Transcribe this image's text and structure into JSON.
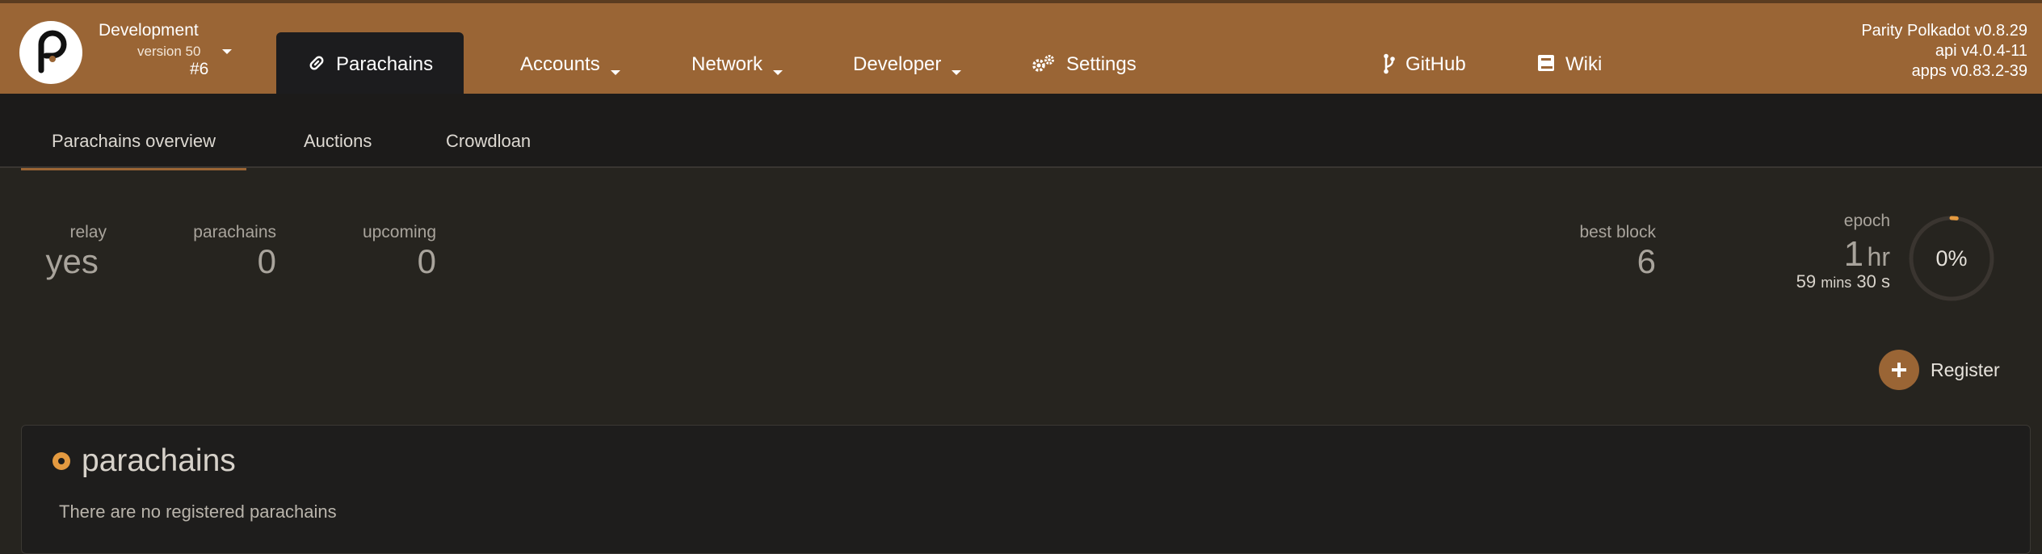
{
  "chain": {
    "name": "Development",
    "version": "version 50",
    "block": "#6"
  },
  "nav": {
    "parachains": "Parachains",
    "accounts": "Accounts",
    "network": "Network",
    "developer": "Developer",
    "settings": "Settings",
    "github": "GitHub",
    "wiki": "Wiki"
  },
  "versions": {
    "node": "Parity Polkadot v0.8.29",
    "api": "api v4.0.4-11",
    "apps": "apps v0.83.2-39"
  },
  "tabs": {
    "overview": "Parachains overview",
    "auctions": "Auctions",
    "crowdloan": "Crowdloan"
  },
  "summary": {
    "relay_label": "relay",
    "relay_value": "yes",
    "parachains_label": "parachains",
    "parachains_value": "0",
    "upcoming_label": "upcoming",
    "upcoming_value": "0",
    "best_block_label": "best block",
    "best_block_value": "6",
    "epoch_label": "epoch",
    "epoch_value": "1",
    "epoch_unit": "hr",
    "epoch_remaining": "59",
    "epoch_mins_label": "mins",
    "epoch_secs": "30",
    "epoch_secs_label": "s",
    "epoch_percent": "0%",
    "epoch_progress": 0.02
  },
  "actions": {
    "register": "Register"
  },
  "panel": {
    "title": "parachains",
    "empty": "There are no registered parachains"
  },
  "colors": {
    "accent": "#9a6535",
    "orange_dot": "#e49a40",
    "background": "#26241f",
    "bar_dark": "#1c1c1e"
  },
  "icons": {
    "logo": "polkadot-p-logo",
    "parachains": "link-icon",
    "settings": "gears-icon",
    "github": "branch-icon",
    "wiki": "book-icon",
    "register": "plus-icon"
  }
}
